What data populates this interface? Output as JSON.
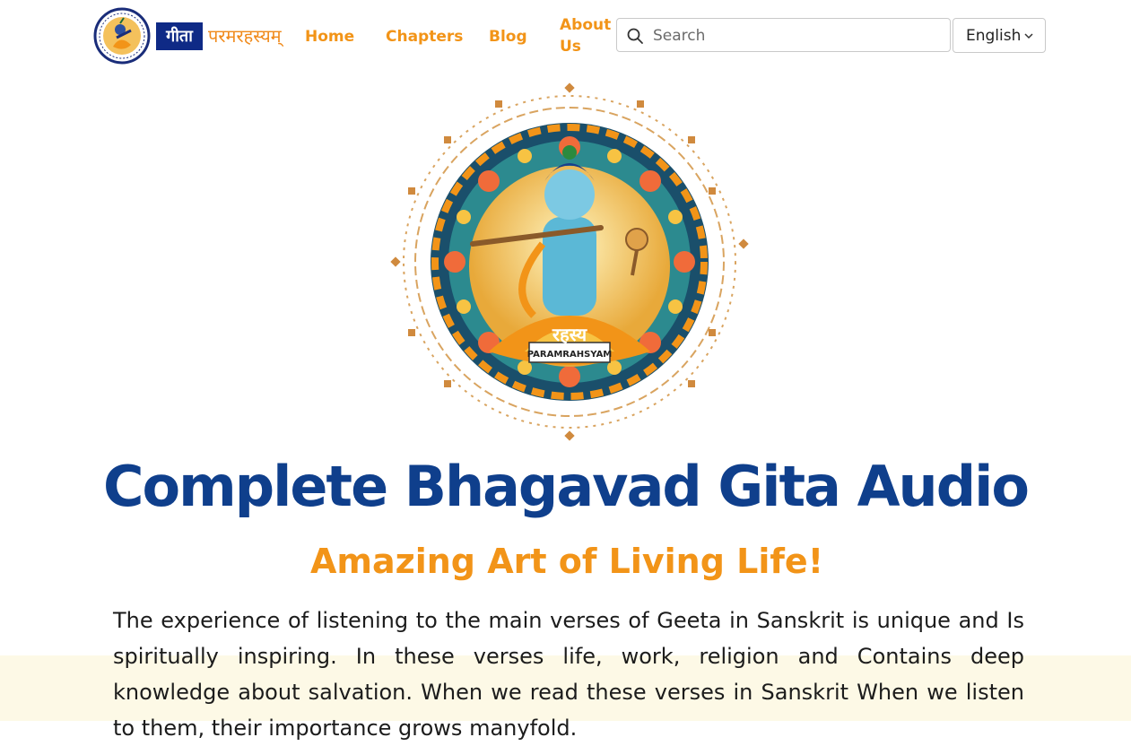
{
  "brand": {
    "logo_box_text": "गीता",
    "logo_text": "परमरहस्यम्",
    "badge_text": "PARAMRAHSYAM",
    "badge_script": "रहस्य"
  },
  "nav": {
    "home": "Home",
    "chapters": "Chapters",
    "blog": "Blog",
    "about": "About Us"
  },
  "search": {
    "placeholder": "Search",
    "value": ""
  },
  "language": {
    "selected": "English"
  },
  "hero": {
    "title": "Complete Bhagavad Gita Audio",
    "subtitle": "Amazing Art of Living Life!",
    "description": "The experience of listening to the main verses of Geeta in Sanskrit is unique and Is spiritually inspiring. In these verses life, work, religion and Contains deep knowledge about salvation. When we read these verses in Sanskrit When we listen to them, their importance grows manyfold."
  },
  "colors": {
    "accent_orange": "#f29418",
    "title_blue": "#0f3f8c",
    "logo_navy": "#0f2a86",
    "cream_band": "#fdf9e6"
  },
  "icons": {
    "search": "search-icon",
    "chevron": "chevron-down-icon",
    "logo": "krishna-logo-icon",
    "hero": "krishna-mandala-illustration"
  }
}
